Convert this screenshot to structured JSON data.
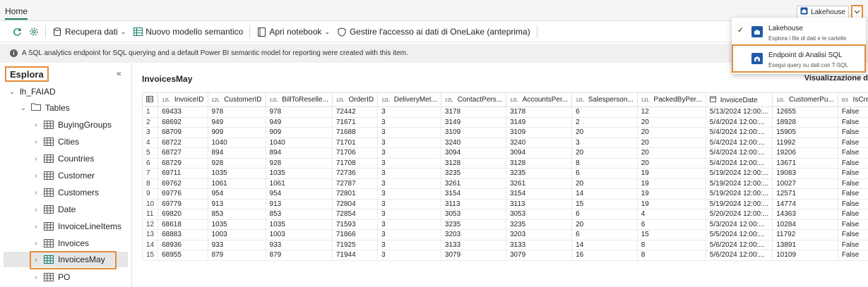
{
  "tab": {
    "home": "Home"
  },
  "switcher": {
    "label": "Lakehouse"
  },
  "ribbon": {
    "refresh": "",
    "settings": "",
    "get_data": "Recupera dati",
    "new_model": "Nuovo modello semantico",
    "open_notebook": "Apri notebook",
    "manage_access": "Gestire l'accesso ai dati di OneLake (anteprima)"
  },
  "info": {
    "message": "A SQL analytics endpoint for SQL querying and a default Power BI semantic model for reporting were created with this item."
  },
  "explorer": {
    "title": "Esplora",
    "lakehouse": "lh_FAIAD",
    "tables_folder": "Tables",
    "tables": [
      "BuyingGroups",
      "Cities",
      "Countries",
      "Customer",
      "Customers",
      "Date",
      "InvoiceLineItems",
      "Invoices",
      "InvoicesMay",
      "PO"
    ]
  },
  "main": {
    "title": "InvoicesMay",
    "view_label": "Visualizzazione d"
  },
  "grid": {
    "columns": [
      {
        "type": "12L",
        "name": "InvoiceID"
      },
      {
        "type": "12L",
        "name": "CustomerID"
      },
      {
        "type": "12L",
        "name": "BillToReselle..."
      },
      {
        "type": "12L",
        "name": "OrderID"
      },
      {
        "type": "12L",
        "name": "DeliveryMet..."
      },
      {
        "type": "12L",
        "name": "ContactPers..."
      },
      {
        "type": "12L",
        "name": "AccountsPer..."
      },
      {
        "type": "12L",
        "name": "Salesperson..."
      },
      {
        "type": "12L",
        "name": "PackedByPer..."
      },
      {
        "type": "date",
        "name": "InvoiceDate"
      },
      {
        "type": "12L",
        "name": "CustomerPu..."
      },
      {
        "type": "0/1",
        "name": "IsCreditNote"
      }
    ],
    "rows": [
      [
        "1",
        "69433",
        "978",
        "978",
        "72442",
        "3",
        "3178",
        "3178",
        "6",
        "12",
        "5/13/2024 12:00:...",
        "12655",
        "False"
      ],
      [
        "2",
        "68692",
        "949",
        "949",
        "71671",
        "3",
        "3149",
        "3149",
        "2",
        "20",
        "5/4/2024 12:00:...",
        "18928",
        "False"
      ],
      [
        "3",
        "68709",
        "909",
        "909",
        "71688",
        "3",
        "3109",
        "3109",
        "20",
        "20",
        "5/4/2024 12:00:...",
        "15905",
        "False"
      ],
      [
        "4",
        "68722",
        "1040",
        "1040",
        "71701",
        "3",
        "3240",
        "3240",
        "3",
        "20",
        "5/4/2024 12:00:...",
        "11992",
        "False"
      ],
      [
        "5",
        "68727",
        "894",
        "894",
        "71706",
        "3",
        "3094",
        "3094",
        "20",
        "20",
        "5/4/2024 12:00:...",
        "19206",
        "False"
      ],
      [
        "6",
        "68729",
        "928",
        "928",
        "71708",
        "3",
        "3128",
        "3128",
        "8",
        "20",
        "5/4/2024 12:00:...",
        "13671",
        "False"
      ],
      [
        "7",
        "69711",
        "1035",
        "1035",
        "72736",
        "3",
        "3235",
        "3235",
        "6",
        "19",
        "5/19/2024 12:00:...",
        "19083",
        "False"
      ],
      [
        "8",
        "69762",
        "1061",
        "1061",
        "72787",
        "3",
        "3261",
        "3261",
        "20",
        "19",
        "5/19/2024 12:00:...",
        "10027",
        "False"
      ],
      [
        "9",
        "69776",
        "954",
        "954",
        "72801",
        "3",
        "3154",
        "3154",
        "14",
        "19",
        "5/19/2024 12:00:...",
        "12571",
        "False"
      ],
      [
        "10",
        "69779",
        "913",
        "913",
        "72804",
        "3",
        "3113",
        "3113",
        "15",
        "19",
        "5/19/2024 12:00:...",
        "14774",
        "False"
      ],
      [
        "11",
        "69820",
        "853",
        "853",
        "72854",
        "3",
        "3053",
        "3053",
        "6",
        "4",
        "5/20/2024 12:00:...",
        "14363",
        "False"
      ],
      [
        "12",
        "68618",
        "1035",
        "1035",
        "71593",
        "3",
        "3235",
        "3235",
        "20",
        "6",
        "5/3/2024 12:00:...",
        "10284",
        "False"
      ],
      [
        "13",
        "68883",
        "1003",
        "1003",
        "71866",
        "3",
        "3203",
        "3203",
        "6",
        "15",
        "5/5/2024 12:00:...",
        "11792",
        "False"
      ],
      [
        "14",
        "68936",
        "933",
        "933",
        "71925",
        "3",
        "3133",
        "3133",
        "14",
        "8",
        "5/6/2024 12:00:...",
        "13891",
        "False"
      ],
      [
        "15",
        "68955",
        "879",
        "879",
        "71944",
        "3",
        "3079",
        "3079",
        "16",
        "8",
        "5/6/2024 12:00:...",
        "10109",
        "False"
      ]
    ]
  },
  "dropdown": {
    "items": [
      {
        "title": "Lakehouse",
        "subtitle": "Esplora i file di dati e le cartelle",
        "checked": true
      },
      {
        "title": "Endpoint di Analisi SQL",
        "subtitle": "Esegui query su dati con T-SQL",
        "checked": false
      }
    ]
  },
  "colors": {
    "accent": "#117865",
    "highlight": "#e38b3a",
    "icon_blue": "#1f5aa6"
  }
}
